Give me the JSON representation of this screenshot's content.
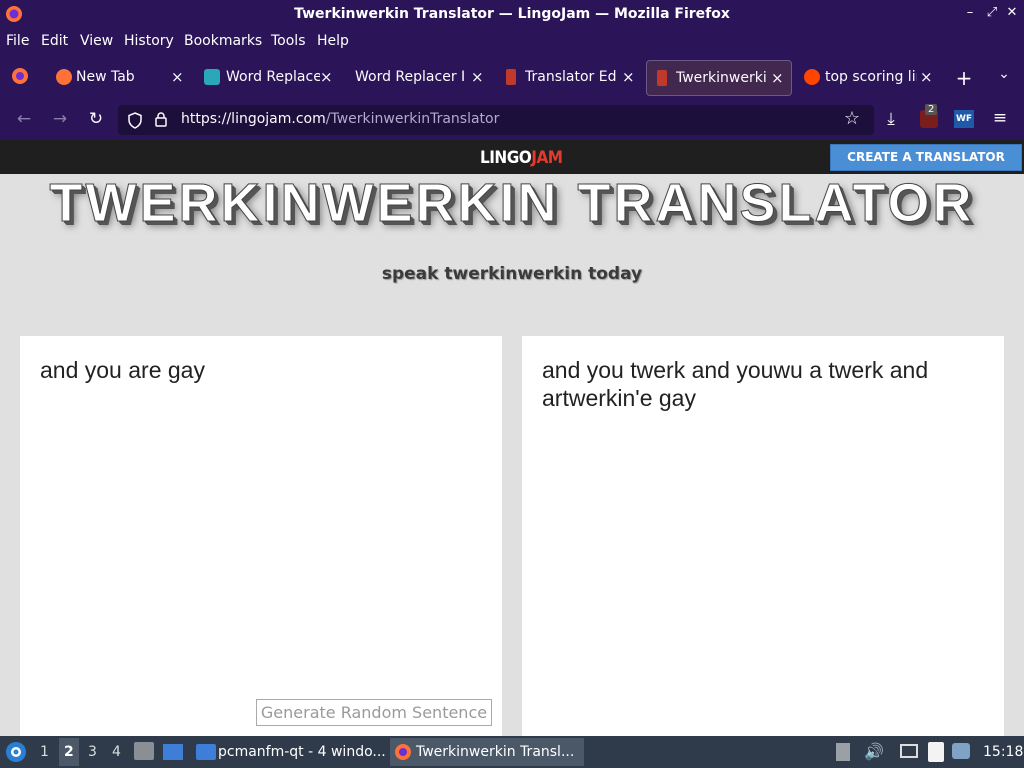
{
  "window": {
    "title": "Twerkinwerkin Translator — LingoJam — Mozilla Firefox"
  },
  "menu": [
    "File",
    "Edit",
    "View",
    "History",
    "Bookmarks",
    "Tools",
    "Help"
  ],
  "tabs": [
    {
      "label": "New Tab"
    },
    {
      "label": "Word Replacer"
    },
    {
      "label": "Word Replacer II"
    },
    {
      "label": "Translator Edit"
    },
    {
      "label": "Twerkinwerkin"
    },
    {
      "label": "top scoring lin"
    }
  ],
  "url": {
    "host": "https://lingojam.com",
    "path": "/TwerkinwerkinTranslator"
  },
  "toolbar": {
    "ublock_badge": "2",
    "ext_label": "WF"
  },
  "lingojam": {
    "logo_lingo": "LINGO",
    "logo_jam": "JAM",
    "create_button": "CREATE A TRANSLATOR",
    "title": "TWERKINWERKIN TRANSLATOR",
    "subtitle": "speak twerkinwerkin today",
    "input_text": "and you are gay",
    "output_text": "and you twerk and youwu a twerk and artwerkin'e gay",
    "random_button": "Generate Random Sentence"
  },
  "taskbar": {
    "workspaces": [
      "1",
      "2",
      "3",
      "4"
    ],
    "items": [
      {
        "label": "pcmanfm-qt - 4 windo..."
      },
      {
        "label": "Twerkinwerkin Transl..."
      }
    ],
    "clock": "15:18"
  },
  "colors": {
    "chrome": "#2b1558",
    "accent_button": "#4a8fd6",
    "logo_jam": "#e23b2e"
  }
}
